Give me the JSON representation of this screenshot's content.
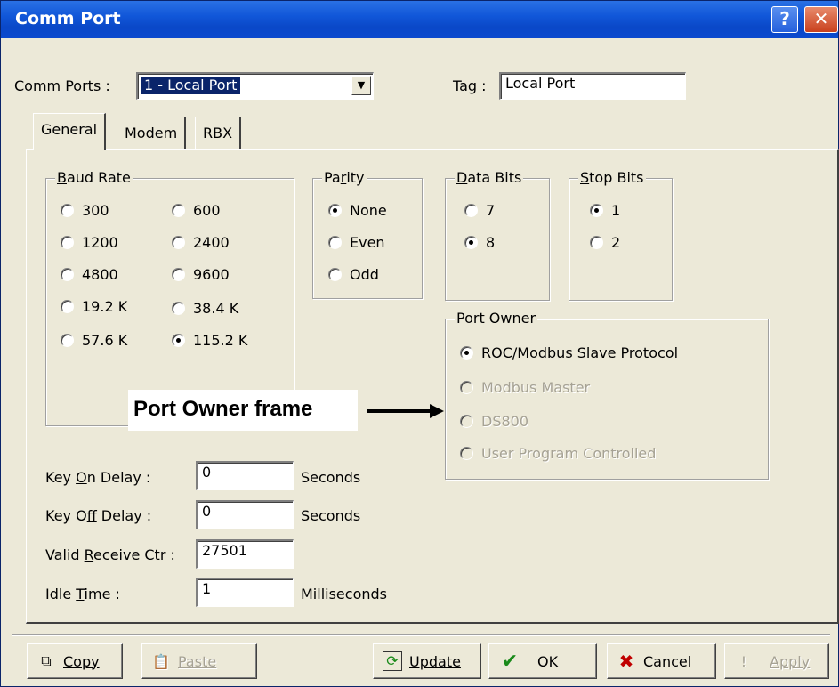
{
  "window": {
    "title": "Comm Port",
    "help_glyph": "?",
    "close_glyph": "✕"
  },
  "header": {
    "comm_ports_label": "Comm Ports :",
    "comm_ports_value": "1 - Local Port",
    "tag_label": "Tag :",
    "tag_value": "Local Port"
  },
  "tabs": [
    "General",
    "Modem",
    "RBX"
  ],
  "baud_rate": {
    "legend": "Baud Rate",
    "options": [
      "300",
      "600",
      "1200",
      "2400",
      "4800",
      "9600",
      "19.2 K",
      "38.4 K",
      "57.6 K",
      "115.2 K"
    ],
    "selected": "115.2 K"
  },
  "parity": {
    "legend": "Parity",
    "options": [
      "None",
      "Even",
      "Odd"
    ],
    "selected": "None"
  },
  "data_bits": {
    "legend": "Data Bits",
    "options": [
      "7",
      "8"
    ],
    "selected": "8"
  },
  "stop_bits": {
    "legend": "Stop Bits",
    "options": [
      "1",
      "2"
    ],
    "selected": "1"
  },
  "port_owner": {
    "legend": "Port Owner",
    "options": [
      "ROC/Modbus Slave Protocol",
      "Modbus Master",
      "DS800",
      "User Program Controlled"
    ],
    "selected": "ROC/Modbus Slave Protocol"
  },
  "fields": {
    "key_on_delay_label": "Key On Delay :",
    "key_on_delay_value": "0",
    "key_on_delay_unit": "Seconds",
    "key_off_delay_label": "Key Off Delay :",
    "key_off_delay_value": "0",
    "key_off_delay_unit": "Seconds",
    "valid_receive_label": "Valid Receive Ctr :",
    "valid_receive_value": "27501",
    "idle_time_label": "Idle Time :",
    "idle_time_value": "1",
    "idle_time_unit": "Milliseconds"
  },
  "annotation": {
    "text": "Port Owner frame"
  },
  "buttons": {
    "copy": "Copy",
    "paste": "Paste",
    "update": "Update",
    "ok": "OK",
    "cancel": "Cancel",
    "apply": "Apply"
  },
  "icons": {
    "copy": "copy-icon",
    "paste": "paste-icon",
    "update": "update-icon",
    "ok": "checkmark-icon",
    "cancel": "x-icon",
    "apply": "exclamation-icon"
  },
  "colors": {
    "titlebar": "#0a48c8",
    "dialog_bg": "#ece9d8",
    "selection": "#0a246a",
    "ok_green": "#1a8a1a",
    "cancel_red": "#c00000"
  }
}
